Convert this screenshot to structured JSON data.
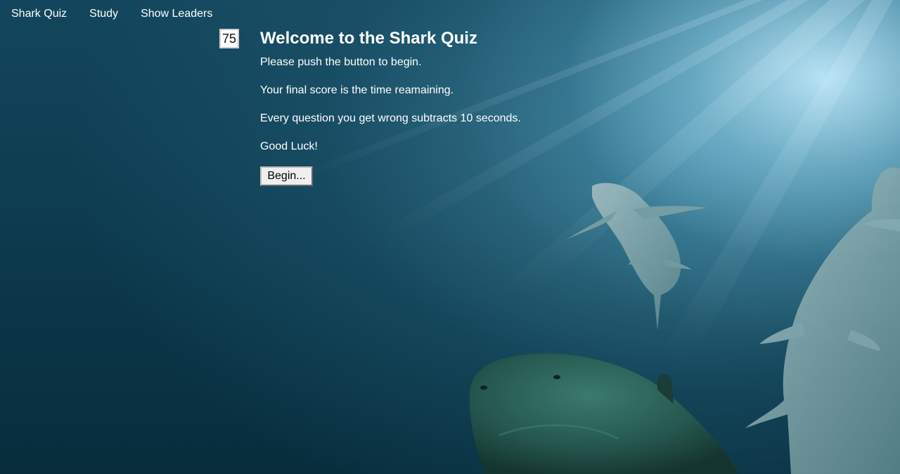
{
  "nav": {
    "items": [
      {
        "label": "Shark Quiz"
      },
      {
        "label": "Study"
      },
      {
        "label": "Show Leaders"
      }
    ]
  },
  "timer": {
    "value": "75"
  },
  "main": {
    "title": "Welcome to the Shark Quiz",
    "paragraphs": [
      "Please push the button to begin.",
      "Your final score is the time reamaining.",
      "Every question you get wrong subtracts 10 seconds.",
      "Good Luck!"
    ],
    "begin_label": "Begin..."
  },
  "colors": {
    "text": "#ffffff",
    "deep_water": "#072d3c",
    "light_ray": "#bee8fa",
    "button_bg": "#efefef"
  }
}
